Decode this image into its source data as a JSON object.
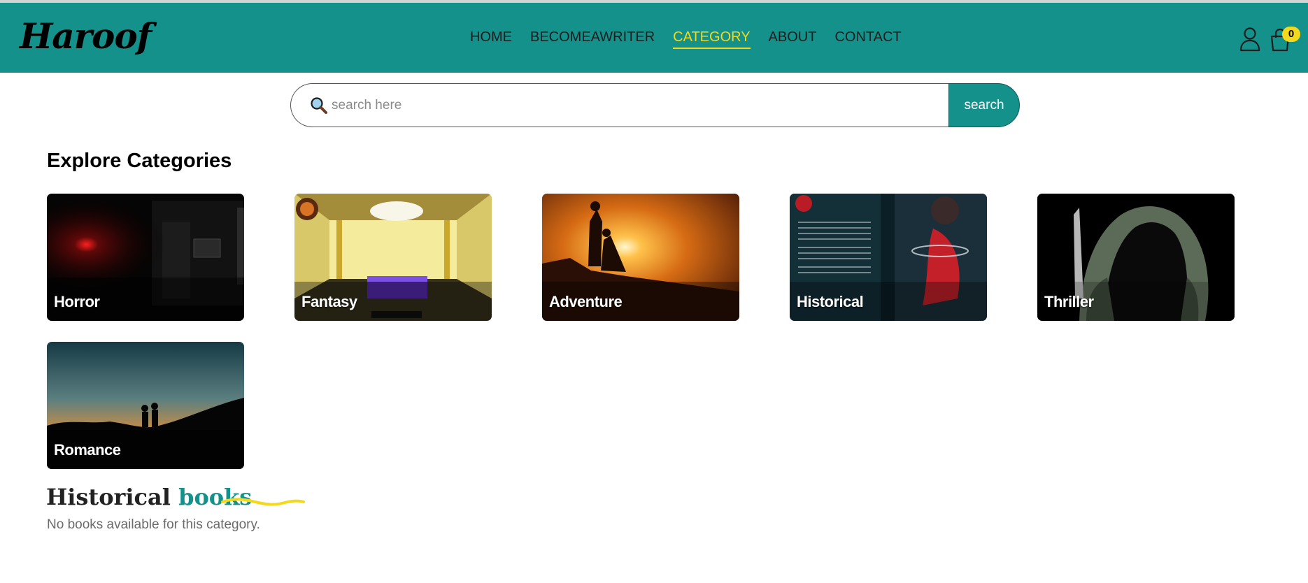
{
  "header": {
    "logo": "Haroof",
    "nav": [
      "HOME",
      "BECOMEAWRITER",
      "CATEGORY",
      "ABOUT",
      "CONTACT"
    ],
    "active_nav": "CATEGORY",
    "cart_count": "0",
    "user_icon": "user-icon",
    "cart_icon": "shopping-bag-icon"
  },
  "search": {
    "placeholder": "search here",
    "button": "search",
    "icon": "magnifier-icon"
  },
  "categories": {
    "title": "Explore Categories",
    "items": [
      "Horror",
      "Fantasy",
      "Adventure",
      "Historical",
      "Thriller",
      "Romance"
    ]
  },
  "books_section": {
    "title_part1": "Historical",
    "title_part2": "books",
    "empty_message": "No books available for this category."
  },
  "colors": {
    "header_bg": "#13918a",
    "accent_yellow": "#f4d81c"
  }
}
